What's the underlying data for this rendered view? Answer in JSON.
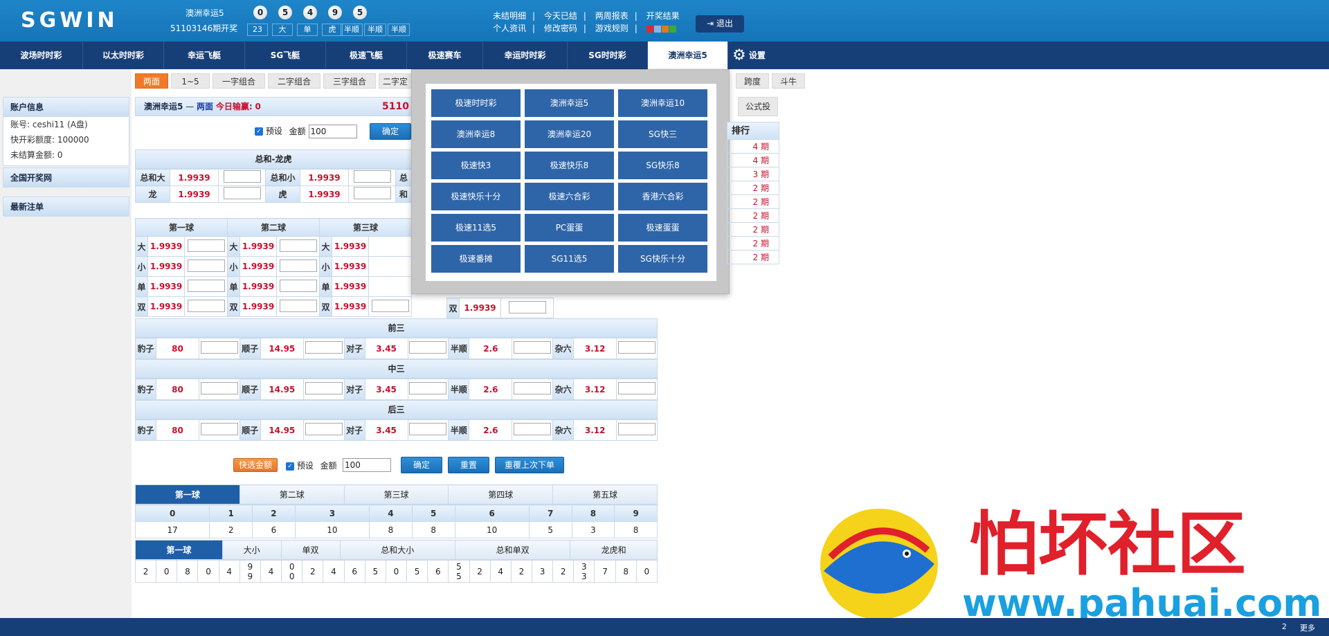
{
  "header": {
    "logo": "SGWIN",
    "lottery_name": "澳洲幸运5",
    "issue_text": "51103146期开奖",
    "balls": [
      "0",
      "5",
      "4",
      "9",
      "5"
    ],
    "results": [
      "23",
      "大",
      "单",
      "虎",
      "半顺",
      "半顺",
      "半顺"
    ],
    "links_row1": [
      "未结明细",
      "今天已结",
      "两周报表",
      "开奖结果"
    ],
    "links_row2": [
      "个人资讯",
      "修改密码",
      "游戏规则"
    ],
    "skin_colors": [
      "#e02a2a",
      "#8ab4e8",
      "#e07a1a",
      "#3aaa3a"
    ],
    "logout": "退出"
  },
  "nav": {
    "items": [
      "波场时时彩",
      "以太时时彩",
      "幸运飞艇",
      "SG飞艇",
      "极速飞艇",
      "极速赛车",
      "幸运时时彩",
      "SG时时彩",
      "澳洲幸运5"
    ],
    "active_index": 8,
    "settings": "设置"
  },
  "sidebar": {
    "account_title": "账户信息",
    "account_rows": [
      "账号: ceshi11 (A盘)",
      "快开彩额度:    100000",
      "未结算金额:    0"
    ],
    "lottery_site": "全国开奖网",
    "latest_bets": "最新注单"
  },
  "subtabs": [
    "两面",
    "1~5",
    "一字组合",
    "二字组合",
    "三字组合",
    "二字定位",
    "跨度",
    "斗牛"
  ],
  "info": {
    "title": "澳洲幸运5",
    "dash": "—",
    "mode": "两面",
    "today_label": "今日输赢:",
    "today_value": "0",
    "issue_fragment": "5110",
    "formula": "公式投"
  },
  "preset": {
    "label": "预设",
    "amount_label": "金额",
    "amount": "100",
    "confirm": "确定"
  },
  "sum_section": {
    "title": "总和-龙虎",
    "rows": [
      [
        "总和大",
        "1.9939",
        "总和小",
        "1.9939",
        "总"
      ],
      [
        "龙",
        "1.9939",
        "虎",
        "1.9939",
        "和"
      ]
    ]
  },
  "balls_section": {
    "heads": [
      "第一球",
      "第二球",
      "第三球"
    ],
    "rows": [
      [
        "大",
        "1.9939"
      ],
      [
        "小",
        "1.9939"
      ],
      [
        "单",
        "1.9939"
      ],
      [
        "双",
        "1.9939"
      ]
    ],
    "col4_double": [
      "双",
      "1.9939"
    ]
  },
  "combo_sections": [
    {
      "title": "前三",
      "items": [
        [
          "豹子",
          "80"
        ],
        [
          "顺子",
          "14.95"
        ],
        [
          "对子",
          "3.45"
        ],
        [
          "半顺",
          "2.6"
        ],
        [
          "杂六",
          "3.12"
        ]
      ]
    },
    {
      "title": "中三",
      "items": [
        [
          "豹子",
          "80"
        ],
        [
          "顺子",
          "14.95"
        ],
        [
          "对子",
          "3.45"
        ],
        [
          "半顺",
          "2.6"
        ],
        [
          "杂六",
          "3.12"
        ]
      ]
    },
    {
      "title": "后三",
      "items": [
        [
          "豹子",
          "80"
        ],
        [
          "顺子",
          "14.95"
        ],
        [
          "对子",
          "3.45"
        ],
        [
          "半顺",
          "2.6"
        ],
        [
          "杂六",
          "3.12"
        ]
      ]
    }
  ],
  "bottom_actions": {
    "quick": "快选金额",
    "preset": "预设",
    "amount_label": "金额",
    "amount": "100",
    "confirm": "确定",
    "reset": "重置",
    "repeat": "重覆上次下单"
  },
  "stats": {
    "tabs": [
      "第一球",
      "第二球",
      "第三球",
      "第四球",
      "第五球"
    ],
    "numbers": [
      "0",
      "1",
      "2",
      "3",
      "4",
      "5",
      "6",
      "7",
      "8",
      "9"
    ],
    "counts": [
      "17",
      "2",
      "6",
      "10",
      "8",
      "8",
      "10",
      "5",
      "3",
      "8"
    ],
    "sub_tabs": [
      "第一球",
      "大小",
      "单双",
      "总和大小",
      "总和单双",
      "龙虎和"
    ],
    "cells": [
      "2",
      "0",
      "8",
      "0",
      "4",
      "9\n9",
      "4",
      "0\n0",
      "2",
      "4",
      "6",
      "5",
      "0",
      "5",
      "6",
      "5\n5",
      "2",
      "4",
      "2",
      "3",
      "2",
      "3\n3",
      "7",
      "8",
      "0"
    ]
  },
  "popup": {
    "items": [
      "极速时时彩",
      "澳洲幸运5",
      "澳洲幸运10",
      "澳洲幸运8",
      "澳洲幸运20",
      "SG快三",
      "极速快3",
      "极速快乐8",
      "SG快乐8",
      "极速快乐十分",
      "极速六合彩",
      "香港六合彩",
      "极速11选5",
      "PC蛋蛋",
      "极速蛋蛋",
      "极速番摊",
      "SG11选5",
      "SG快乐十分"
    ]
  },
  "ranking": {
    "title": "排行",
    "rows": [
      "4 期",
      "4 期",
      "3 期",
      "2 期",
      "2 期",
      "2 期",
      "2 期",
      "2 期",
      "2 期"
    ]
  },
  "footer": {
    "page": "2",
    "more": "更多"
  },
  "watermark": {
    "text": "怕坏社区",
    "url": "www.pahuai.com"
  }
}
